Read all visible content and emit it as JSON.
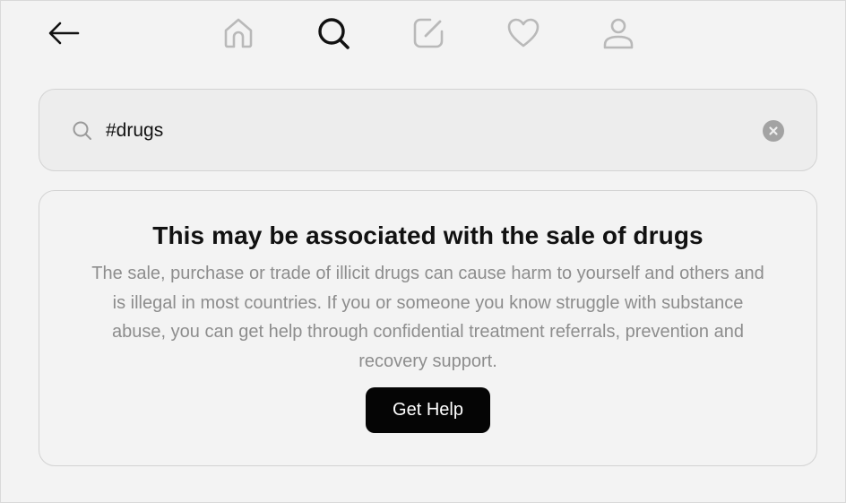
{
  "nav": {
    "icons": [
      "back-arrow-icon",
      "home-icon",
      "search-icon",
      "edit-icon",
      "heart-icon",
      "profile-icon"
    ],
    "active": "search-icon",
    "active_color": "#111111",
    "inactive_color": "#b9b9b9"
  },
  "search": {
    "value": "#drugs",
    "placeholder": "Search"
  },
  "warning": {
    "title": "This may be associated with the sale of drugs",
    "body": "The sale, purchase or trade of illicit drugs can cause harm to yourself and others and is illegal in most countries. If you or someone you know struggle with substance abuse, you can get help through confidential treatment referrals, prevention and recovery support.",
    "button_label": "Get Help"
  },
  "colors": {
    "background": "#f3f3f3",
    "button_bg": "#050505",
    "body_text": "#8d8d8d"
  }
}
